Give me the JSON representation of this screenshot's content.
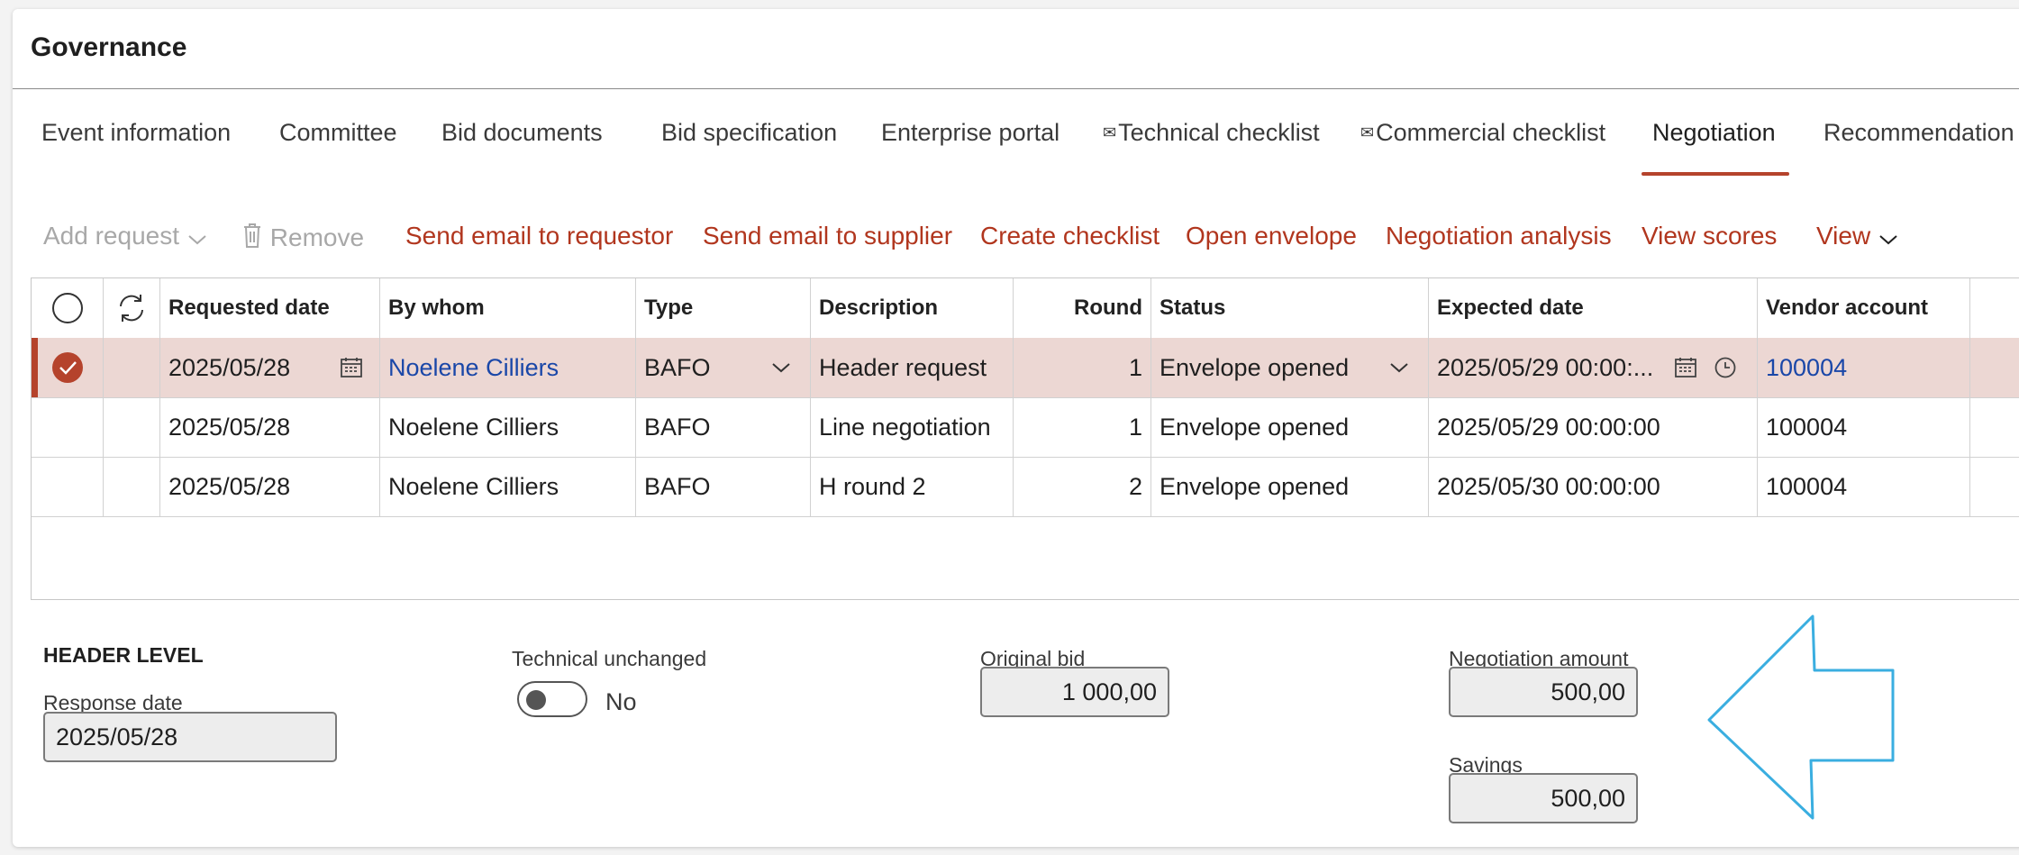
{
  "page": {
    "title": "Governance"
  },
  "tabs": [
    {
      "label": "Event information"
    },
    {
      "label": "Committee"
    },
    {
      "label": "Bid documents"
    },
    {
      "label": "Bid specification"
    },
    {
      "label": "Enterprise portal"
    },
    {
      "label": "Technical checklist",
      "icon": "envelope-icon"
    },
    {
      "label": "Commercial checklist",
      "icon": "envelope-icon"
    },
    {
      "label": "Negotiation",
      "active": true
    },
    {
      "label": "Recommendation"
    }
  ],
  "toolbar": {
    "add_request": "Add request",
    "remove": "Remove",
    "send_email_requestor": "Send email to requestor",
    "send_email_supplier": "Send email to supplier",
    "create_checklist": "Create checklist",
    "open_envelope": "Open envelope",
    "negotiation_analysis": "Negotiation analysis",
    "view_scores": "View scores",
    "view": "View"
  },
  "grid": {
    "columns": [
      "Requested date",
      "By whom",
      "Type",
      "Description",
      "Round",
      "Status",
      "Expected date",
      "Vendor account"
    ],
    "rows": [
      {
        "requested_date": "2025/05/28",
        "by_whom": "Noelene Cilliers",
        "type": "BAFO",
        "description": "Header request",
        "round": "1",
        "status": "Envelope opened",
        "expected_date": "2025/05/29 00:00:...",
        "vendor_account": "100004",
        "selected": true
      },
      {
        "requested_date": "2025/05/28",
        "by_whom": "Noelene Cilliers",
        "type": "BAFO",
        "description": "Line negotiation",
        "round": "1",
        "status": "Envelope opened",
        "expected_date": "2025/05/29 00:00:00",
        "vendor_account": "100004"
      },
      {
        "requested_date": "2025/05/28",
        "by_whom": "Noelene Cilliers",
        "type": "BAFO",
        "description": "H round 2",
        "round": "2",
        "status": "Envelope opened",
        "expected_date": "2025/05/30 00:00:00",
        "vendor_account": "100004"
      }
    ]
  },
  "header_level": {
    "section_title": "HEADER LEVEL",
    "response_date_label": "Response date",
    "response_date": "2025/05/28",
    "technical_unchanged_label": "Technical unchanged",
    "technical_unchanged_value": "No",
    "original_bid_label": "Original bid",
    "original_bid": "1 000,00",
    "negotiation_amount_label": "Negotiation amount",
    "negotiation_amount": "500,00",
    "savings_label": "Savings",
    "savings": "500,00"
  },
  "colors": {
    "accent": "#b5432c",
    "action_text": "#b1361e",
    "link": "#1a47a8",
    "selected_row": "#ecd7d3",
    "annotation_arrow": "#3aaee0"
  }
}
